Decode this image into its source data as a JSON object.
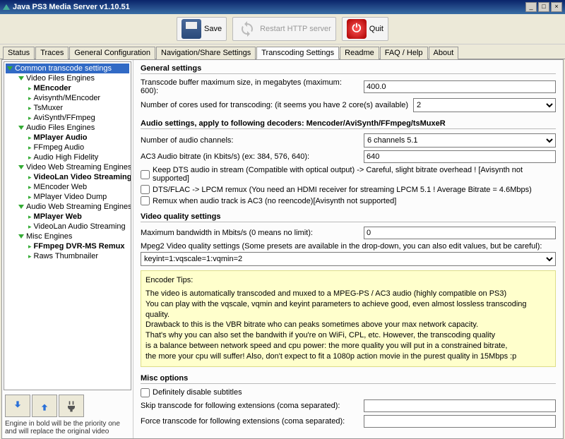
{
  "window": {
    "title": "Java PS3 Media Server v1.10.51"
  },
  "toolbar": {
    "save": "Save",
    "restart": "Restart HTTP server",
    "quit": "Quit"
  },
  "tabs": [
    "Status",
    "Traces",
    "General Configuration",
    "Navigation/Share Settings",
    "Transcoding Settings",
    "Readme",
    "FAQ / Help",
    "About"
  ],
  "active_tab": "Transcoding Settings",
  "tree": {
    "root": "Common transcode settings",
    "groups": [
      {
        "label": "Video Files Engines",
        "items": [
          {
            "t": "MEncoder",
            "b": true
          },
          {
            "t": "Avisynth/MEncoder"
          },
          {
            "t": "TsMuxer"
          },
          {
            "t": "AviSynth/FFmpeg"
          }
        ]
      },
      {
        "label": "Audio Files Engines",
        "items": [
          {
            "t": "MPlayer Audio",
            "b": true
          },
          {
            "t": "FFmpeg Audio"
          },
          {
            "t": "Audio High Fidelity"
          }
        ]
      },
      {
        "label": "Video Web Streaming Engines",
        "items": [
          {
            "t": "VideoLan Video Streaming",
            "b": true
          },
          {
            "t": "MEncoder Web"
          },
          {
            "t": "MPlayer Video Dump"
          }
        ]
      },
      {
        "label": "Audio Web Streaming Engines",
        "items": [
          {
            "t": "MPlayer Web",
            "b": true
          },
          {
            "t": "VideoLan Audio Streaming"
          }
        ]
      },
      {
        "label": "Misc Engines",
        "items": [
          {
            "t": "FFmpeg DVR-MS Remux",
            "b": true
          },
          {
            "t": "Raws Thumbnailer"
          }
        ]
      }
    ]
  },
  "note": "Engine in bold will be the priority one and will replace the original video",
  "general": {
    "title": "General settings",
    "buffer_lbl": "Transcode buffer maximum size, in megabytes (maximum: 600):",
    "buffer_val": "400.0",
    "cores_lbl": "Number of cores used for transcoding: (it seems you have 2 core(s) available)",
    "cores_val": "2"
  },
  "audio": {
    "title": "Audio settings, apply to following decoders: Mencoder/AviSynth/FFmpeg/tsMuxeR",
    "channels_lbl": "Number of audio channels:",
    "channels_val": "6 channels 5.1",
    "ac3_lbl": "AC3 Audio bitrate (in Kbits/s) (ex: 384, 576, 640):",
    "ac3_val": "640",
    "dts": "Keep DTS audio in stream (Compatible with optical output) -> Careful, slight bitrate overhead ! [Avisynth not supported]",
    "lpcm": "DTS/FLAC -> LPCM remux (You need an HDMI receiver for streaming LPCM 5.1 ! Average Bitrate = 4.6Mbps)",
    "remux": "Remux when audio track is AC3 (no reencode)[Avisynth not supported]"
  },
  "video": {
    "title": "Video quality settings",
    "bw_lbl": "Maximum bandwidth in Mbits/s (0 means no limit):",
    "bw_val": "0",
    "mpeg2_lbl": "Mpeg2 Video quality settings (Some presets are available in the drop-down, you can also edit values, but be careful):",
    "mpeg2_val": "keyint=1:vqscale=1:vqmin=2",
    "tips_title": "Encoder Tips:",
    "tips_body": "The video is automatically transcoded and muxed to a MPEG-PS / AC3 audio (highly compatible on PS3)\nYou can play with the vqscale, vqmin and keyint parameters to achieve good, even almost lossless transcoding quality.\nDrawback to this is the VBR bitrate who can peaks sometimes above your max network capacity.\nThat's why you can also set the bandwith if you're on WiFi, CPL, etc. However, the transcoding quality\nis a balance between network speed and cpu power: the more quality you will put in a constrained bitrate,\nthe more your cpu will suffer! Also, don't expect to fit a 1080p action movie in the purest quality in 15Mbps :p"
  },
  "misc": {
    "title": "Misc options",
    "subs": "Definitely disable subtitles",
    "skip_lbl": "Skip transcode for following extensions (coma separated):",
    "force_lbl": "Force transcode for following extensions (coma separated):"
  }
}
